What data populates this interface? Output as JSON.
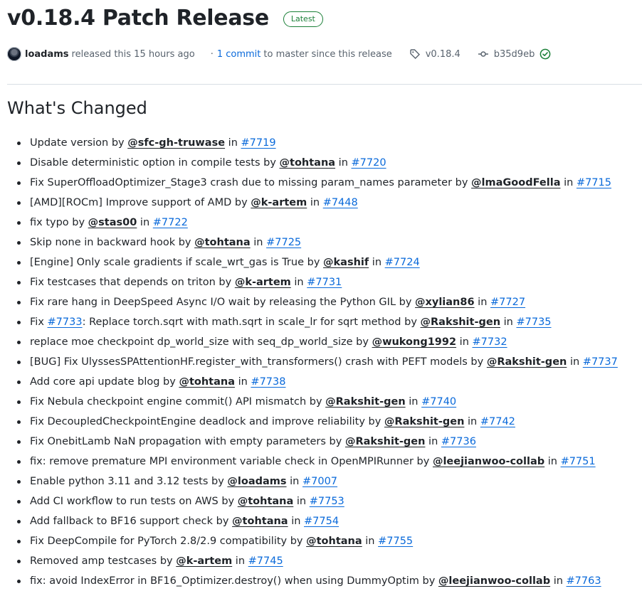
{
  "release": {
    "title": "v0.18.4 Patch Release",
    "badge": "Latest",
    "author": "loadams",
    "released_text": "released this 15 hours ago",
    "separator": "·",
    "commits_link": "1 commit",
    "commits_suffix": "to master since this release",
    "tag": "v0.18.4",
    "sha": "b35d9eb"
  },
  "section_title": "What's Changed",
  "changes": [
    {
      "pre": "",
      "ref": "",
      "text": "Update version by ",
      "user": "@sfc-gh-truwase",
      "in": " in ",
      "pr": "#7719"
    },
    {
      "pre": "",
      "ref": "",
      "text": "Disable deterministic option in compile tests by ",
      "user": "@tohtana",
      "in": " in ",
      "pr": "#7720"
    },
    {
      "pre": "",
      "ref": "",
      "text": "Fix SuperOffloadOptimizer_Stage3 crash due to missing param_names parameter by ",
      "user": "@lmaGoodFella",
      "in": " in ",
      "pr": "#7715"
    },
    {
      "pre": "",
      "ref": "",
      "text": "[AMD][ROCm] Improve support of AMD by ",
      "user": "@k-artem",
      "in": " in ",
      "pr": "#7448"
    },
    {
      "pre": "",
      "ref": "",
      "text": "fix typo by ",
      "user": "@stas00",
      "in": " in ",
      "pr": "#7722"
    },
    {
      "pre": "",
      "ref": "",
      "text": "Skip none in backward hook by ",
      "user": "@tohtana",
      "in": " in ",
      "pr": "#7725"
    },
    {
      "pre": "",
      "ref": "",
      "text": "[Engine] Only scale gradients if scale_wrt_gas is True by ",
      "user": "@kashif",
      "in": " in ",
      "pr": "#7724"
    },
    {
      "pre": "",
      "ref": "",
      "text": "Fix testcases that depends on triton by ",
      "user": "@k-artem",
      "in": " in ",
      "pr": "#7731"
    },
    {
      "pre": "",
      "ref": "",
      "text": "Fix rare hang in DeepSpeed Async I/O wait by releasing the Python GIL by ",
      "user": "@xylian86",
      "in": " in ",
      "pr": "#7727"
    },
    {
      "pre": "Fix ",
      "ref": "#7733",
      "text": ": Replace torch.sqrt with math.sqrt in scale_lr for sqrt method by ",
      "user": "@Rakshit-gen",
      "in": " in ",
      "pr": "#7735"
    },
    {
      "pre": "",
      "ref": "",
      "text": "replace moe checkpoint dp_world_size with seq_dp_world_size by ",
      "user": "@wukong1992",
      "in": " in ",
      "pr": "#7732"
    },
    {
      "pre": "",
      "ref": "",
      "text": "[BUG] Fix UlyssesSPAttentionHF.register_with_transformers() crash with PEFT models by ",
      "user": "@Rakshit-gen",
      "in": " in ",
      "pr": "#7737"
    },
    {
      "pre": "",
      "ref": "",
      "text": "Add core api update blog by ",
      "user": "@tohtana",
      "in": " in ",
      "pr": "#7738"
    },
    {
      "pre": "",
      "ref": "",
      "text": "Fix Nebula checkpoint engine commit() API mismatch by ",
      "user": "@Rakshit-gen",
      "in": " in ",
      "pr": "#7740"
    },
    {
      "pre": "",
      "ref": "",
      "text": "Fix DecoupledCheckpointEngine deadlock and improve reliability by ",
      "user": "@Rakshit-gen",
      "in": " in ",
      "pr": "#7742"
    },
    {
      "pre": "",
      "ref": "",
      "text": "Fix OnebitLamb NaN propagation with empty parameters by ",
      "user": "@Rakshit-gen",
      "in": " in ",
      "pr": "#7736"
    },
    {
      "pre": "",
      "ref": "",
      "text": "fix: remove premature MPI environment variable check in OpenMPIRunner by ",
      "user": "@leejianwoo-collab",
      "in": " in ",
      "pr": "#7751"
    },
    {
      "pre": "",
      "ref": "",
      "text": "Enable python 3.11 and 3.12 tests by ",
      "user": "@loadams",
      "in": " in ",
      "pr": "#7007"
    },
    {
      "pre": "",
      "ref": "",
      "text": "Add CI workflow to run tests on AWS by ",
      "user": "@tohtana",
      "in": " in ",
      "pr": "#7753"
    },
    {
      "pre": "",
      "ref": "",
      "text": "Add fallback to BF16 support check by ",
      "user": "@tohtana",
      "in": " in ",
      "pr": "#7754"
    },
    {
      "pre": "",
      "ref": "",
      "text": "Fix DeepCompile for PyTorch 2.8/2.9 compatibility by ",
      "user": "@tohtana",
      "in": " in ",
      "pr": "#7755"
    },
    {
      "pre": "",
      "ref": "",
      "text": "Removed amp testcases by ",
      "user": "@k-artem",
      "in": " in ",
      "pr": "#7745"
    },
    {
      "pre": "",
      "ref": "",
      "text": "fix: avoid IndexError in BF16_Optimizer.destroy() when using DummyOptim by ",
      "user": "@leejianwoo-collab",
      "in": " in ",
      "pr": "#7763"
    }
  ],
  "icons": {
    "tag": "tag-icon",
    "commit": "git-commit-icon",
    "verified": "check-circle-icon"
  },
  "colors": {
    "link": "#0969da",
    "latest": "#1a7f37",
    "muted": "#59636e",
    "text": "#1f2328"
  }
}
